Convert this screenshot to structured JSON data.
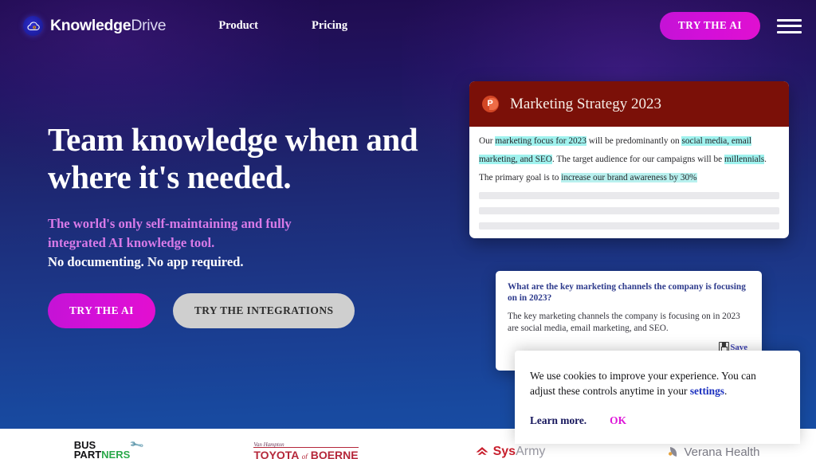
{
  "brand": {
    "name_bold": "Knowledge",
    "name_light": "Drive",
    "icon": "cloud-icon"
  },
  "nav": {
    "links": [
      {
        "label": "Product"
      },
      {
        "label": "Pricing"
      }
    ],
    "cta_label": "TRY THE AI",
    "menu_icon": "hamburger-menu-icon"
  },
  "hero": {
    "title": "Team knowledge when and where it's needed.",
    "subtitle_accent_line1": "The world's only self-maintaining and fully",
    "subtitle_accent_line2": "integrated AI knowledge tool.",
    "subtitle_plain": "No documenting. No app required.",
    "primary_cta": "TRY THE AI",
    "secondary_cta": "TRY THE INTEGRATIONS"
  },
  "slide_card": {
    "app_icon": "powerpoint-icon",
    "app_icon_letter": "P",
    "title": "Marketing Strategy 2023",
    "line1_a": "Our ",
    "line1_hl1": "marketing focus for 2023",
    "line1_b": " will be predominantly on ",
    "line1_hl2": "social media, email",
    "line2_hl1": "marketing, and SEO",
    "line2_b": ". The target audience for our campaigns will be ",
    "line2_hl2": "millennials",
    "line2_c": ".",
    "line3_a": "The primary goal is to ",
    "line3_hl": "increase our brand awareness by 30%"
  },
  "qa_card": {
    "question": "What are the key marketing channels the company is focusing on in 2023?",
    "answer": "The key marketing channels the company is focusing on in 2023 are social media, email marketing, and SEO.",
    "save_label": "Save",
    "save_icon": "floppy-disk-icon"
  },
  "cookie_banner": {
    "text_before": "We use cookies to improve your experience. You can adjust these controls anytime in your ",
    "settings_link": "settings",
    "text_after": ".",
    "learn_more": "Learn more.",
    "ok": "OK"
  },
  "footer_logos": [
    {
      "name": "bus-partners",
      "line1": "BUS",
      "line2_dark": "PART",
      "line2_accent": "NERS",
      "icon": "wrench-icon"
    },
    {
      "name": "toyota-of-boerne",
      "script": "Van Hampton",
      "main": "TOYOTA",
      "connector": "of",
      "main2": "BOERNE"
    },
    {
      "name": "sysarmy",
      "bold": "Sys",
      "light": "Army",
      "icon": "home-chevron-icon"
    },
    {
      "name": "verana-health",
      "label": "Verana Health",
      "icon": "leaf-icon"
    }
  ],
  "colors": {
    "accent_magenta": "#d40fd8",
    "accent_pink": "#d87ae8",
    "bg_top": "#1e0b4e",
    "bg_bottom": "#1650a8",
    "slide_header": "#7b1008",
    "highlight_cyan": "#9ff2ee",
    "link_blue": "#1a2fbf"
  }
}
